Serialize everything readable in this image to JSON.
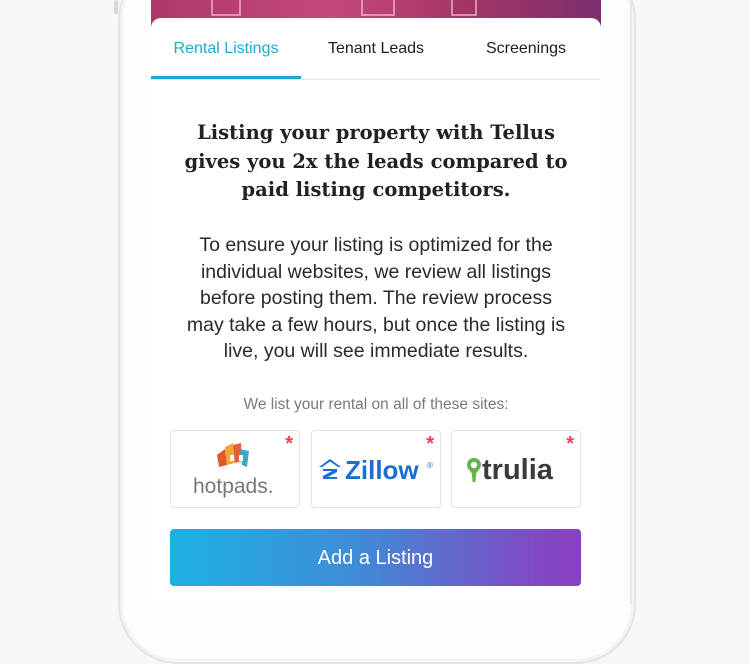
{
  "tabs": [
    {
      "label": "Rental Listings",
      "active": true
    },
    {
      "label": "Tenant Leads",
      "active": false
    },
    {
      "label": "Screenings",
      "active": false
    }
  ],
  "headline": [
    "Listing your property with Tellus",
    "gives you 2x the leads compared to",
    "paid listing competitors."
  ],
  "body": [
    "To ensure your listing is optimized for the",
    "individual websites, we review all listings",
    "before posting them. The review process",
    "may take a few hours, but once the listing is",
    "live, you will see immediate results."
  ],
  "sites_label": "We list your rental on all of these sites:",
  "sites": [
    {
      "name": "hotpads",
      "wordmark": "hotpads.",
      "icon": "hotpads-logo-icon",
      "marker": "*"
    },
    {
      "name": "zillow",
      "wordmark": "Zillow",
      "registered": "®",
      "icon": "zillow-logo-icon",
      "marker": "*"
    },
    {
      "name": "trulia",
      "wordmark": "trulia",
      "icon": "trulia-pin-icon",
      "marker": "*"
    }
  ],
  "cta_label": "Add a Listing",
  "colors": {
    "accent": "#1fa8d5",
    "asterisk": "#e5435a",
    "cta_start": "#1eb1e4",
    "cta_end": "#8a3fbf",
    "zillow_blue": "#1a6fd1",
    "trulia_green": "#62b548"
  }
}
